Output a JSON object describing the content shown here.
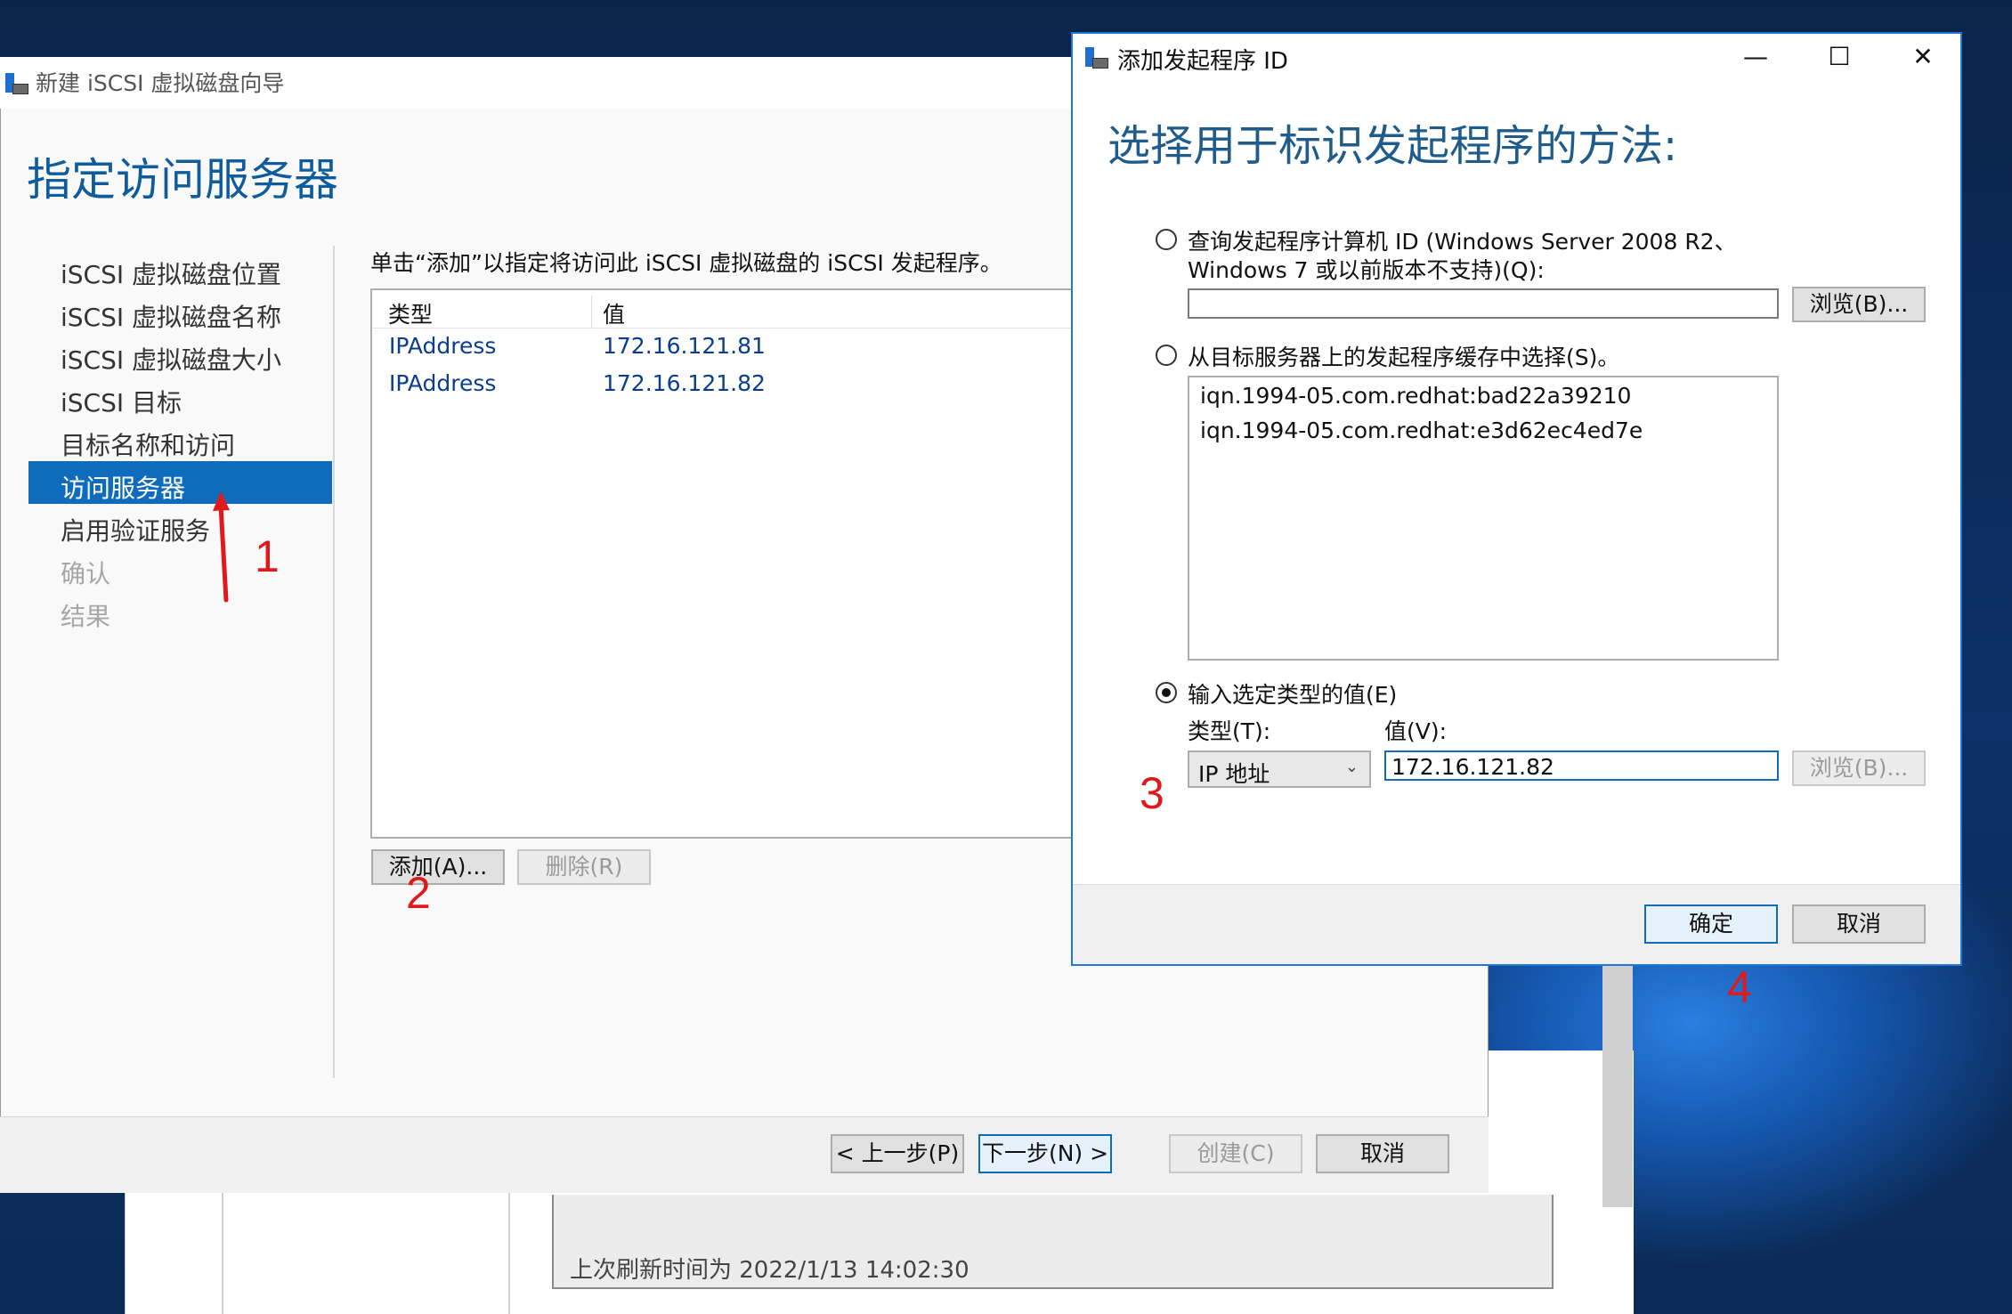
{
  "wizard": {
    "title": "新建 iSCSI 虚拟磁盘向导",
    "heading": "指定访问服务器",
    "nav": [
      {
        "label": "iSCSI 虚拟磁盘位置",
        "state": "normal"
      },
      {
        "label": "iSCSI 虚拟磁盘名称",
        "state": "normal"
      },
      {
        "label": "iSCSI 虚拟磁盘大小",
        "state": "normal"
      },
      {
        "label": "iSCSI 目标",
        "state": "normal"
      },
      {
        "label": "目标名称和访问",
        "state": "normal"
      },
      {
        "label": "访问服务器",
        "state": "selected"
      },
      {
        "label": "启用验证服务",
        "state": "normal"
      },
      {
        "label": "确认",
        "state": "disabled"
      },
      {
        "label": "结果",
        "state": "disabled"
      }
    ],
    "instruction": "单击“添加”以指定将访问此 iSCSI 虚拟磁盘的 iSCSI 发起程序。",
    "list_headers": {
      "type": "类型",
      "value": "值"
    },
    "rows": [
      {
        "type": "IPAddress",
        "value": "172.16.121.81"
      },
      {
        "type": "IPAddress",
        "value": "172.16.121.82"
      }
    ],
    "add_button": "添加(A)...",
    "remove_button": "删除(R)",
    "prev_button": "< 上一步(P)",
    "next_button": "下一步(N) >",
    "create_button": "创建(C)",
    "cancel_button": "取消"
  },
  "background": {
    "status_text": "上次刷新时间为 2022/1/13 14:02:30"
  },
  "dialog": {
    "title": "添加发起程序 ID",
    "heading": "选择用于标识发起程序的方法:",
    "option_query_line1": "查询发起程序计算机 ID (Windows Server 2008 R2、",
    "option_query_line2": "Windows 7 或以前版本不支持)(Q):",
    "query_value": "",
    "browse_button": "浏览(B)...",
    "option_cache": "从目标服务器上的发起程序缓存中选择(S)。",
    "cache_items": [
      "iqn.1994-05.com.redhat:bad22a39210",
      "iqn.1994-05.com.redhat:e3d62ec4ed7e"
    ],
    "option_enter": "输入选定类型的值(E)",
    "type_label": "类型(T):",
    "value_label": "值(V):",
    "type_selected": "IP 地址",
    "value_input": "172.16.121.82",
    "browse_button_disabled": "浏览(B)...",
    "ok_button": "确定",
    "cancel_button": "取消",
    "window_controls": {
      "minimize": "—",
      "maximize": "☐",
      "close": "✕"
    }
  },
  "annotations": [
    "1",
    "2",
    "3",
    "4"
  ],
  "colors": {
    "accent": "#0f6cbd",
    "heading": "#0e5c9c",
    "annotation": "#e0191b"
  }
}
